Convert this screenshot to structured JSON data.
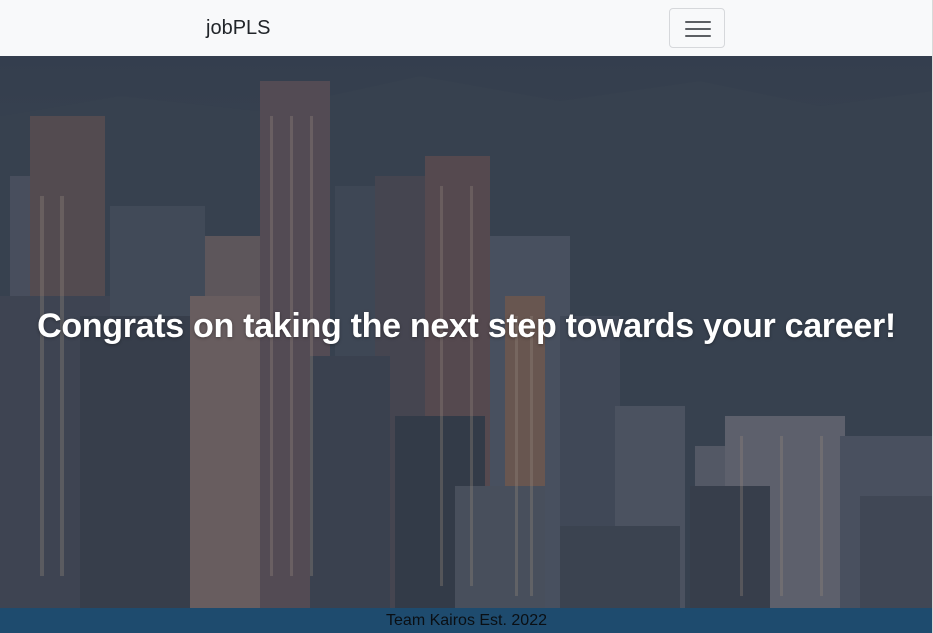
{
  "navbar": {
    "brand": "jobPLS",
    "toggler_icon": "hamburger-menu-icon"
  },
  "hero": {
    "background": "city-skyline-photo",
    "headline": "Congrats on taking the next step towards your career!"
  },
  "footer": {
    "text": "Team Kairos Est. 2022"
  },
  "colors": {
    "navbar_bg": "#f8f9fa",
    "footer_bg": "#1e4b6e",
    "headline": "#ffffff"
  }
}
